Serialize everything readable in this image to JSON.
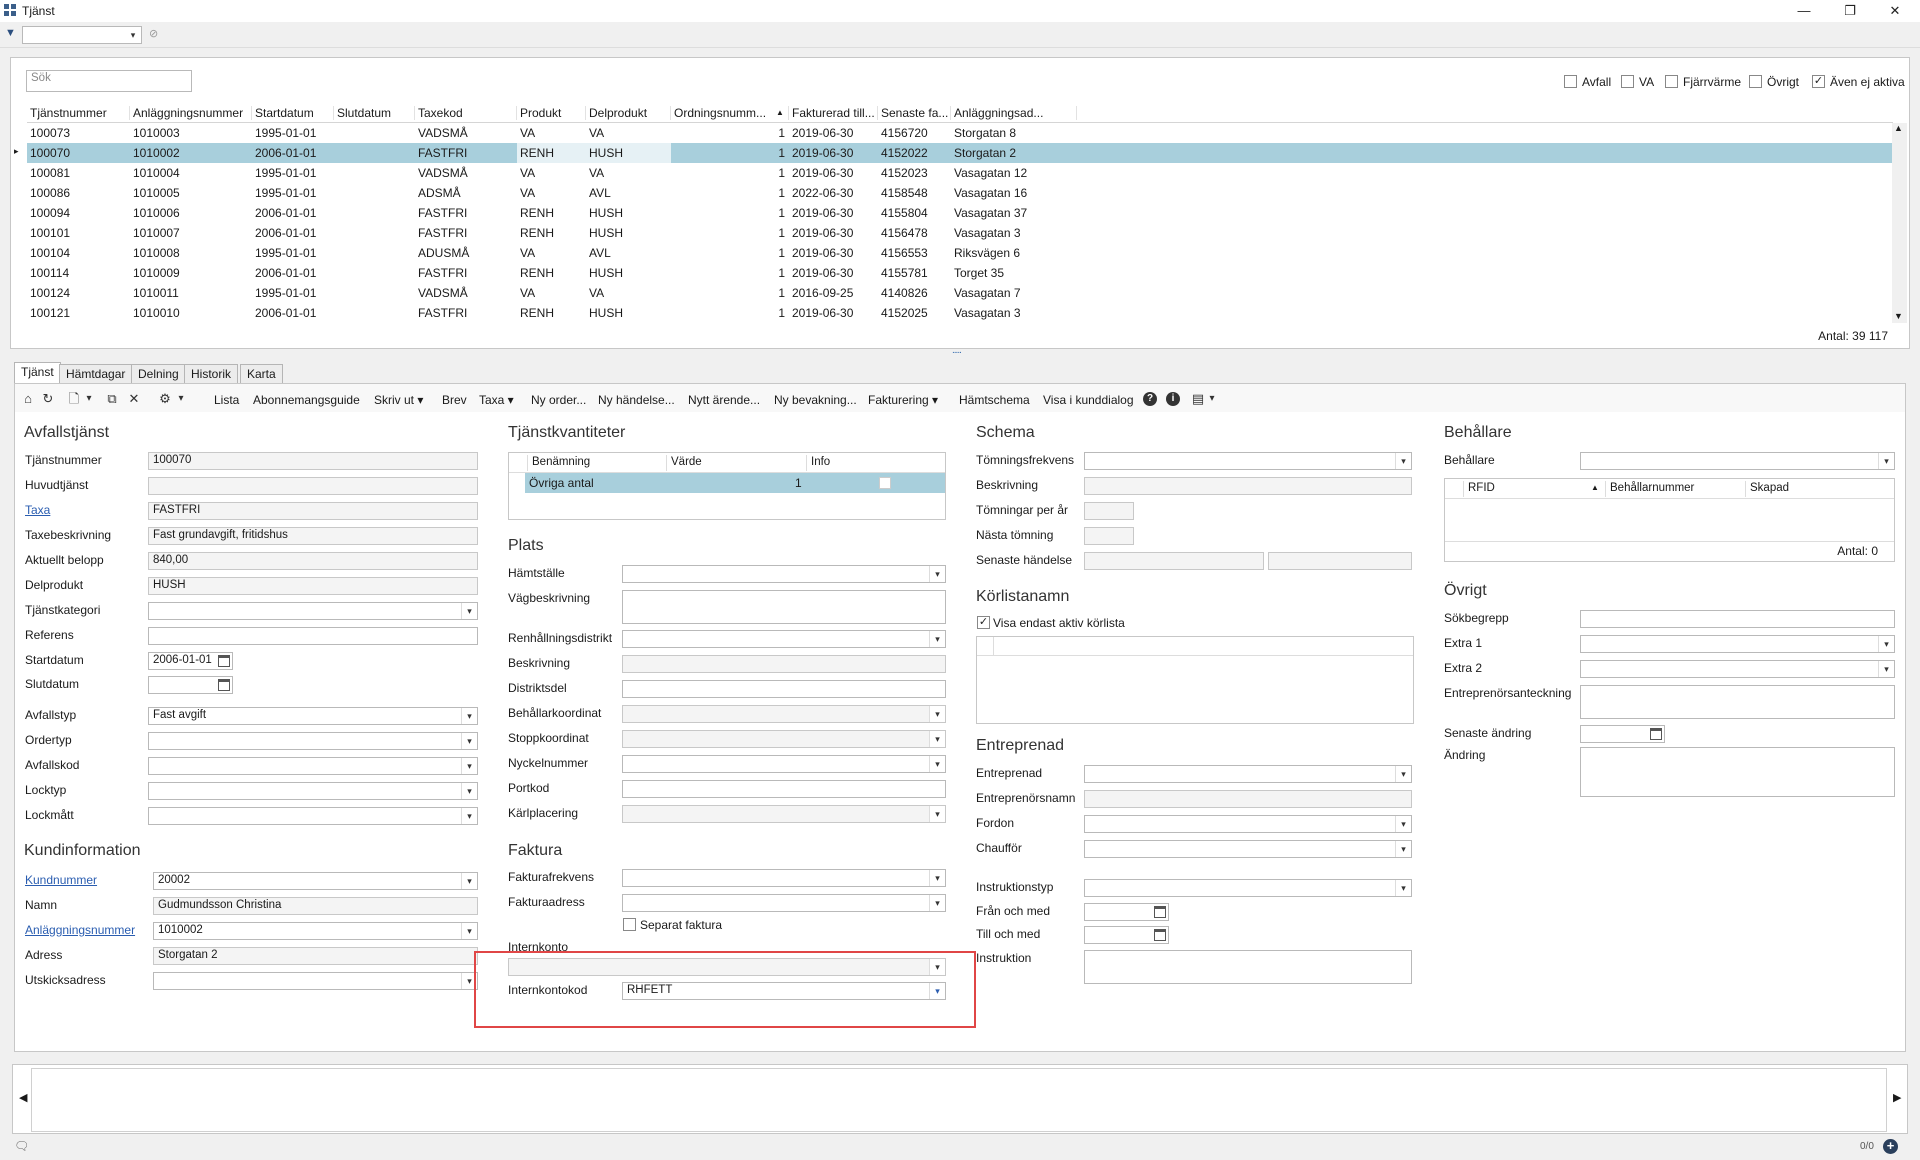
{
  "window": {
    "title": "Tjänst",
    "min_glyph": "—",
    "max_glyph": "❐",
    "close_glyph": "✕"
  },
  "filter": {
    "funnel_glyph": "▼",
    "value": "",
    "dd_glyph": "▾",
    "clear_glyph": "⊘"
  },
  "search": {
    "placeholder": "Sök"
  },
  "checks": [
    {
      "label": "Avfall",
      "checked": false,
      "mark": ""
    },
    {
      "label": "VA",
      "checked": false,
      "mark": ""
    },
    {
      "label": "Fjärrvärme",
      "checked": false,
      "mark": ""
    },
    {
      "label": "Övrigt",
      "checked": false,
      "mark": ""
    },
    {
      "label": "Även ej aktiva",
      "checked": true,
      "mark": "✓"
    }
  ],
  "grid": {
    "columns": [
      "Tjänstnummer",
      "Anläggningsnummer",
      "Startdatum",
      "Slutdatum",
      "Taxekod",
      "Produkt",
      "Delprodukt",
      "Ordningsnumm...",
      "Fakturerad till...",
      "Senaste fa...",
      "Anläggningsad..."
    ],
    "sort_glyph": "▲",
    "row_marker": "▸",
    "rows": [
      [
        "100073",
        "1010003",
        "1995-01-01",
        "",
        "VADSMÅ",
        "VA",
        "VA",
        "1",
        "2019-06-30",
        "4156720",
        "Storgatan 8"
      ],
      [
        "100070",
        "1010002",
        "2006-01-01",
        "",
        "FASTFRI",
        "RENH",
        "HUSH",
        "1",
        "2019-06-30",
        "4152022",
        "Storgatan 2"
      ],
      [
        "100081",
        "1010004",
        "1995-01-01",
        "",
        "VADSMÅ",
        "VA",
        "VA",
        "1",
        "2019-06-30",
        "4152023",
        "Vasagatan 12"
      ],
      [
        "100086",
        "1010005",
        "1995-01-01",
        "",
        "ADSMÅ",
        "VA",
        "AVL",
        "1",
        "2022-06-30",
        "4158548",
        "Vasagatan 16"
      ],
      [
        "100094",
        "1010006",
        "2006-01-01",
        "",
        "FASTFRI",
        "RENH",
        "HUSH",
        "1",
        "2019-06-30",
        "4155804",
        "Vasagatan 37"
      ],
      [
        "100101",
        "1010007",
        "2006-01-01",
        "",
        "FASTFRI",
        "RENH",
        "HUSH",
        "1",
        "2019-06-30",
        "4156478",
        "Vasagatan 3"
      ],
      [
        "100104",
        "1010008",
        "1995-01-01",
        "",
        "ADUSMÅ",
        "VA",
        "AVL",
        "1",
        "2019-06-30",
        "4156553",
        "Riksvägen 6"
      ],
      [
        "100114",
        "1010009",
        "2006-01-01",
        "",
        "FASTFRI",
        "RENH",
        "HUSH",
        "1",
        "2019-06-30",
        "4155781",
        "Torget 35"
      ],
      [
        "100124",
        "1010011",
        "1995-01-01",
        "",
        "VADSMÅ",
        "VA",
        "VA",
        "1",
        "2016-09-25",
        "4140826",
        "Vasagatan 7"
      ],
      [
        "100121",
        "1010010",
        "2006-01-01",
        "",
        "FASTFRI",
        "RENH",
        "HUSH",
        "1",
        "2019-06-30",
        "4152025",
        "Vasagatan 3"
      ]
    ],
    "count": "Antal: 39 117",
    "scroll_up": "▲",
    "scroll_down": "▼",
    "splitter": "....."
  },
  "tabs": [
    "Tjänst",
    "Hämtdagar",
    "Delning",
    "Historik",
    "Karta"
  ],
  "toolbar": {
    "icons": {
      "home": "⌂",
      "refresh": "↻",
      "new": "🗋",
      "new_dd": "▾",
      "copy": "⧉",
      "delete": "✕",
      "tools": "⚙",
      "tools_dd": "▾",
      "help": "?",
      "info": "i",
      "layout": "▤",
      "layout_dd": "▾"
    },
    "items": [
      "Lista",
      "Abonnemangsguide",
      "Skriv ut ▾",
      "Brev",
      "Taxa ▾",
      "Ny order...",
      "Ny händelse...",
      "Nytt ärende...",
      "Ny bevakning...",
      "Fakturering ▾",
      "Hämtschema",
      "Visa i kunddialog"
    ]
  },
  "dd_glyph": "▾",
  "avfallstjanst": {
    "title": "Avfallstjänst",
    "fields": [
      {
        "label": "Tjänstnummer",
        "value": "100070"
      },
      {
        "label": "Huvudtjänst",
        "value": ""
      },
      {
        "label": "Taxa",
        "value": "FASTFRI"
      },
      {
        "label": "Taxebeskrivning",
        "value": "Fast grundavgift, fritidshus"
      },
      {
        "label": "Aktuellt belopp",
        "value": "840,00"
      },
      {
        "label": "Delprodukt",
        "value": "HUSH"
      },
      {
        "label": "Tjänstkategori",
        "value": ""
      },
      {
        "label": "Referens",
        "value": ""
      },
      {
        "label": "Startdatum",
        "value": "2006-01-01"
      },
      {
        "label": "Slutdatum",
        "value": ""
      },
      {
        "label": "Avfallstyp",
        "value": "Fast avgift"
      },
      {
        "label": "Ordertyp",
        "value": ""
      },
      {
        "label": "Avfallskod",
        "value": ""
      },
      {
        "label": "Locktyp",
        "value": ""
      },
      {
        "label": "Lockmått",
        "value": ""
      }
    ]
  },
  "kundinformation": {
    "title": "Kundinformation",
    "fields": [
      {
        "label": "Kundnummer",
        "value": "20002"
      },
      {
        "label": "Namn",
        "value": "Gudmundsson Christina"
      },
      {
        "label": "Anläggningsnummer",
        "value": "1010002"
      },
      {
        "label": "Adress",
        "value": "Storgatan 2"
      },
      {
        "label": "Utskicksadress",
        "value": ""
      }
    ]
  },
  "tjanstkvantiteter": {
    "title": "Tjänstkvantiteter",
    "columns": [
      "Benämning",
      "Värde",
      "Info"
    ],
    "row": {
      "name": "Övriga antal",
      "value": "1"
    }
  },
  "plats": {
    "title": "Plats",
    "fields": [
      {
        "label": "Hämtställe",
        "value": ""
      },
      {
        "label": "Vägbeskrivning",
        "value": ""
      },
      {
        "label": "Renhållningsdistrikt",
        "value": ""
      },
      {
        "label": "Beskrivning",
        "value": ""
      },
      {
        "label": "Distriktsdel",
        "value": ""
      },
      {
        "label": "Behållarkoordinat",
        "value": ""
      },
      {
        "label": "Stoppkoordinat",
        "value": ""
      },
      {
        "label": "Nyckelnummer",
        "value": ""
      },
      {
        "label": "Portkod",
        "value": ""
      },
      {
        "label": "Kärlplacering",
        "value": ""
      }
    ]
  },
  "faktura": {
    "title": "Faktura",
    "fields": [
      {
        "label": "Fakturafrekvens",
        "value": ""
      },
      {
        "label": "Fakturaadress",
        "value": ""
      }
    ],
    "separat": {
      "label": "Separat faktura",
      "mark": ""
    },
    "internkonto": {
      "label": "Internkonto",
      "value": ""
    },
    "internkontokod": {
      "label": "Internkontokod",
      "value": "RHFETT"
    }
  },
  "schema": {
    "title": "Schema",
    "fields": [
      {
        "label": "Tömningsfrekvens",
        "value": ""
      },
      {
        "label": "Beskrivning",
        "value": ""
      },
      {
        "label": "Tömningar per år",
        "value": ""
      },
      {
        "label": "Nästa tömning",
        "value": ""
      },
      {
        "label": "Senaste händelse",
        "value": "",
        "value2": ""
      }
    ]
  },
  "korlistanamn": {
    "title": "Körlistanamn",
    "check_label": "Visa endast aktiv körlista",
    "mark": "✓"
  },
  "entreprenad": {
    "title": "Entreprenad",
    "fields": [
      {
        "label": "Entreprenad",
        "value": ""
      },
      {
        "label": "Entreprenörsnamn",
        "value": ""
      },
      {
        "label": "Fordon",
        "value": ""
      },
      {
        "label": "Chaufför",
        "value": ""
      },
      {
        "label": "Instruktionstyp",
        "value": ""
      },
      {
        "label": "Från och med",
        "value": ""
      },
      {
        "label": "Till och med",
        "value": ""
      },
      {
        "label": "Instruktion",
        "value": ""
      }
    ]
  },
  "behallare": {
    "title": "Behållare",
    "label": "Behållare",
    "value": "",
    "columns": [
      "RFID",
      "Behållarnummer",
      "Skapad"
    ],
    "sort_glyph": "▲",
    "count": "Antal: 0"
  },
  "ovrigt": {
    "title": "Övrigt",
    "fields": [
      {
        "label": "Sökbegrepp",
        "value": ""
      },
      {
        "label": "Extra 1",
        "value": ""
      },
      {
        "label": "Extra 2",
        "value": ""
      },
      {
        "label": "Entreprenörsanteckning",
        "value": ""
      },
      {
        "label": "Senaste ändring",
        "value": ""
      },
      {
        "label": "Ändring",
        "value": ""
      }
    ]
  },
  "bottom": {
    "left_arrow": "◀",
    "right_arrow": "▶",
    "count": "0/0",
    "add": "+",
    "note_icon": "🗨"
  }
}
